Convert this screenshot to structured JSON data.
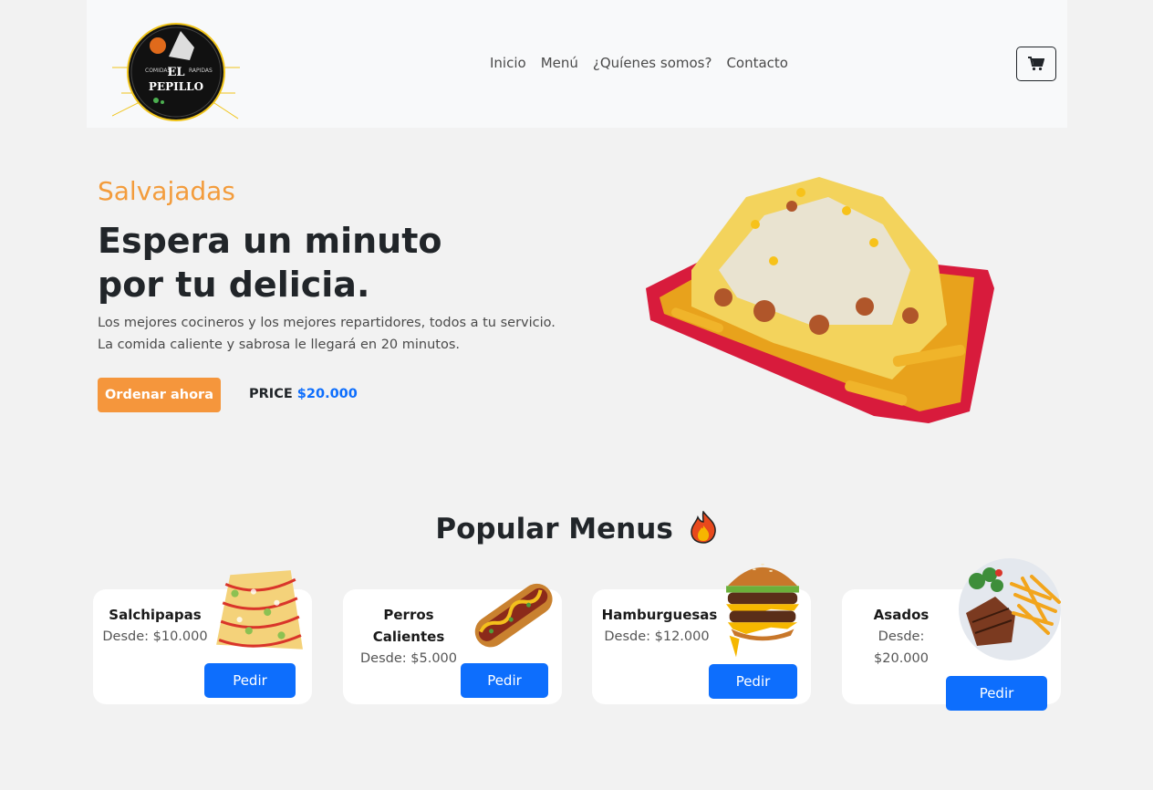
{
  "brand": {
    "logo_line1": "EL",
    "logo_line2": "PEPILLO",
    "logo_small_left": "COMIDAS",
    "logo_small_right": "RAPIDAS"
  },
  "nav": {
    "links": [
      "Inicio",
      "Menú",
      "¿Quíenes somos?",
      "Contacto"
    ],
    "cart_icon": "cart-icon"
  },
  "hero": {
    "subtitle": "Salvajadas",
    "title_line1": "Espera un minuto",
    "title_line2": "por tu delicia.",
    "text": "Los mejores cocineros y los mejores repartidores, todos a tu servicio. La comida caliente y sabrosa le llegará en 20 minutos.",
    "order_label": "Ordenar ahora",
    "price_label": "PRICE",
    "price_value": "$20.000"
  },
  "popular": {
    "title": "Popular Menus",
    "title_icon": "fire-icon",
    "cards": [
      {
        "name": "Salchipapas",
        "price": "Desde: $10.000",
        "button": "Pedir"
      },
      {
        "name": "Perros Calientes",
        "price": "Desde: $5.000",
        "button": "Pedir"
      },
      {
        "name": "Hamburguesas",
        "price": "Desde: $12.000",
        "button": "Pedir"
      },
      {
        "name": "Asados",
        "price": "Desde: $20.000",
        "button": "Pedir"
      }
    ]
  },
  "colors": {
    "accent_orange": "#f5963c",
    "primary_blue": "#0d6efd",
    "background": "#f2f2f2"
  }
}
